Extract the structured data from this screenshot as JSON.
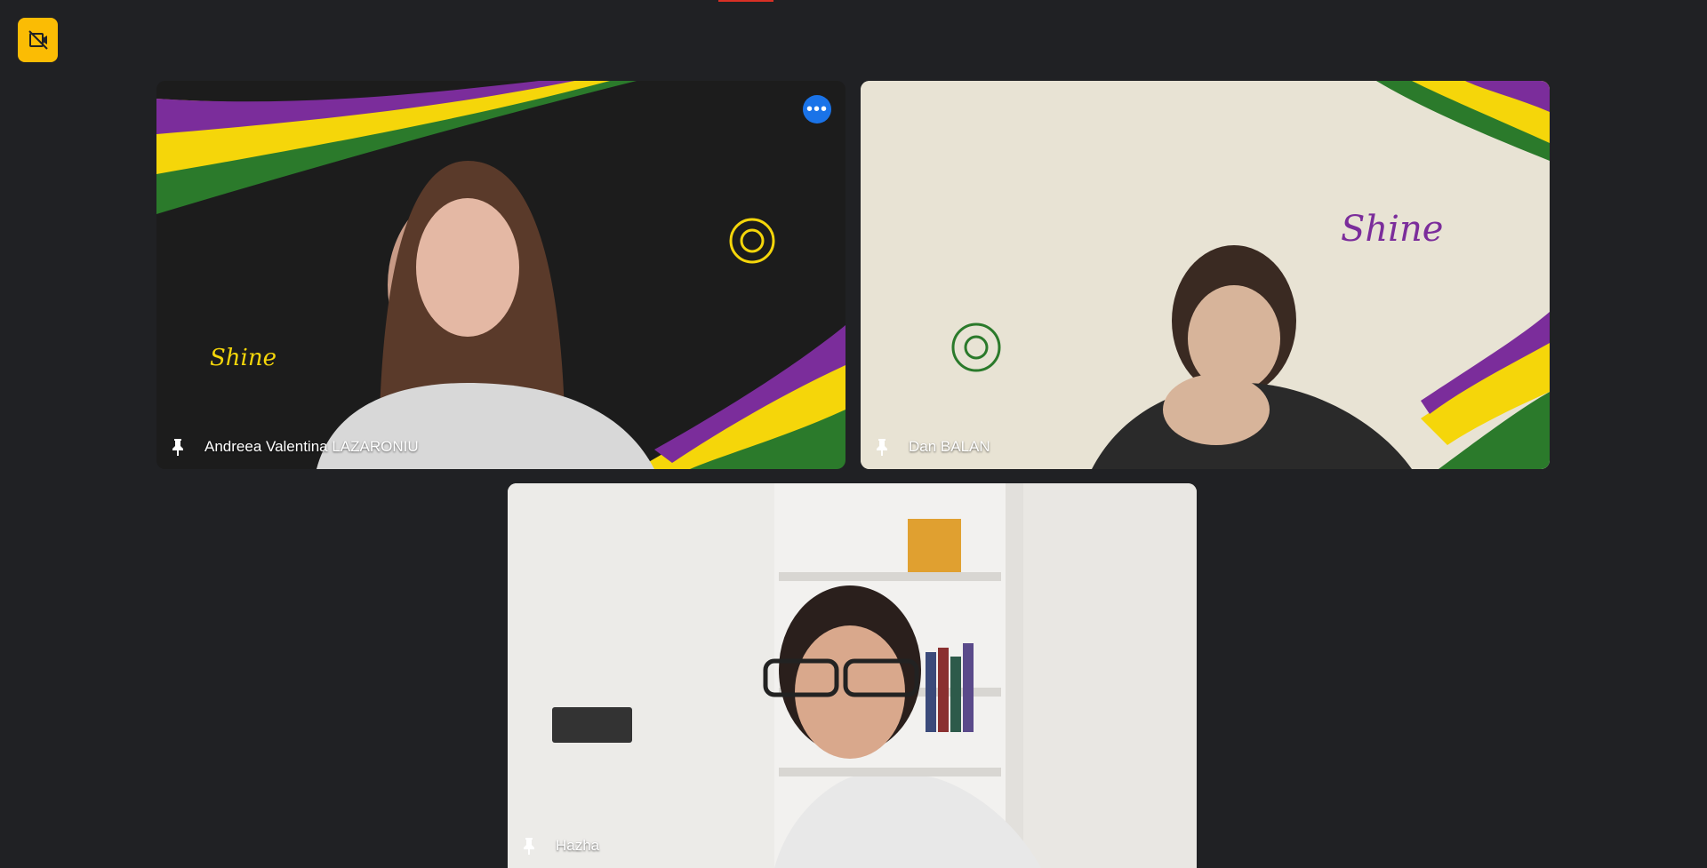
{
  "meeting": {
    "participants": [
      {
        "name": "Andreea Valentina LAZARONIU"
      },
      {
        "name": "Dan BALAN"
      },
      {
        "name": "Hazha"
      }
    ],
    "more_options_glyph": "•••"
  },
  "icons": {
    "camera_status": "camera-off-icon",
    "pin": "pin-icon",
    "more": "more-horizontal-icon"
  },
  "colors": {
    "background": "#202124",
    "camera_badge": "#fbbc04",
    "more_button": "#1a73e8",
    "recording": "#d93025",
    "brand_purple": "#7b2d9b",
    "brand_yellow": "#f5d60a",
    "brand_green": "#2b7a2b"
  }
}
